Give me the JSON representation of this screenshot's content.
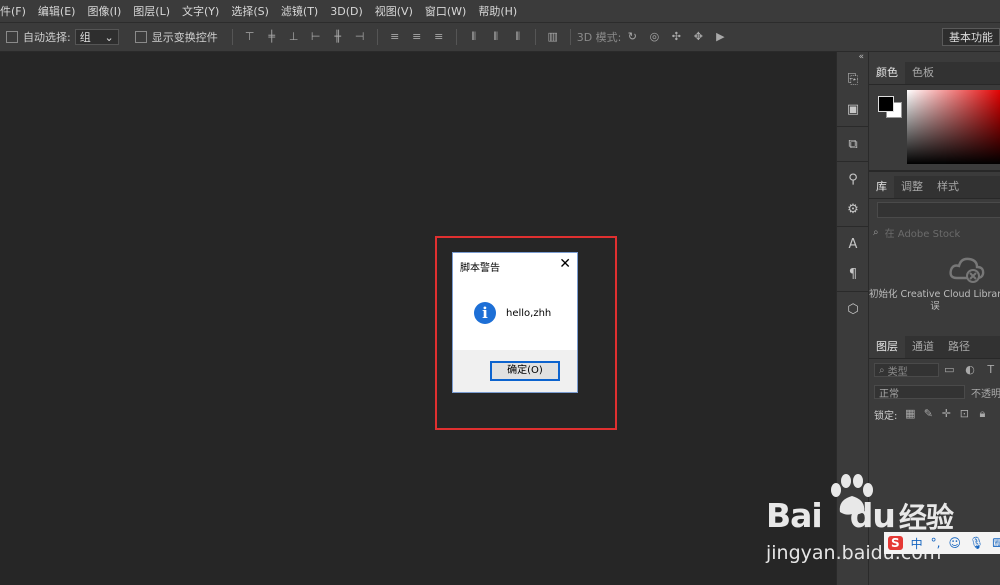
{
  "menu": [
    "件(F)",
    "编辑(E)",
    "图像(I)",
    "图层(L)",
    "文字(Y)",
    "选择(S)",
    "滤镜(T)",
    "3D(D)",
    "视图(V)",
    "窗口(W)",
    "帮助(H)"
  ],
  "options": {
    "auto_select_label": "自动选择:",
    "auto_select_value": "组",
    "show_transform_label": "显示变换控件",
    "mode_3d_label": "3D 模式:",
    "workspace_label": "基本功能"
  },
  "panels": {
    "color_tabs": [
      "颜色",
      "色板"
    ],
    "library_tabs": [
      "库",
      "调整",
      "样式"
    ],
    "library_search_placeholder": "在 Adobe Stock",
    "library_message": "初始化 Creative Cloud Libraries",
    "library_message_line2": "误",
    "layers_tabs": [
      "图层",
      "通道",
      "路径"
    ],
    "layers_kind_placeholder": "类型",
    "blend_mode": "正常",
    "opacity_label": "不透明",
    "lock_label": "锁定:"
  },
  "dialog": {
    "title": "脚本警告",
    "message": "hello,zhh",
    "ok_label": "确定(O)",
    "info_glyph": "i",
    "close_glyph": "✕"
  },
  "watermark": {
    "logo_text": "Bai",
    "logo_text2": "du",
    "logo_text3": "经验",
    "url": "jingyan.baidu.com"
  },
  "ime": {
    "lang": "中",
    "punct": "°,"
  },
  "colors": {
    "accent_blue": "#1d6fd6",
    "highlight_red": "#e03030",
    "app_bg": "#262626",
    "panel_bg": "#3b3b3b"
  }
}
